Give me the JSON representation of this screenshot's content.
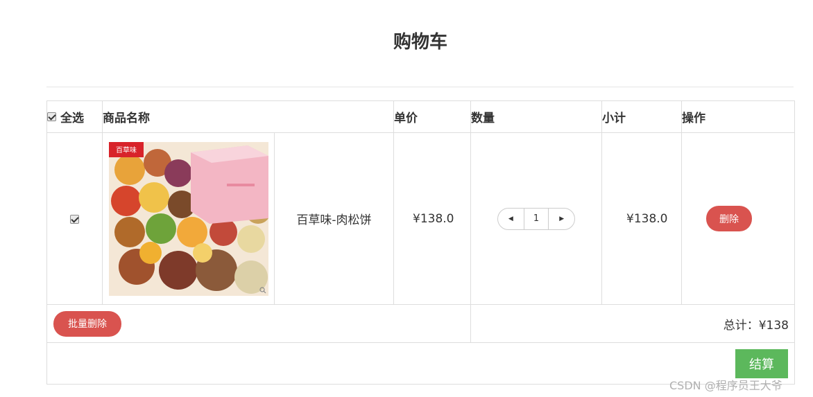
{
  "page": {
    "title": "购物车"
  },
  "table": {
    "headers": {
      "select_all": "全选",
      "product_name": "商品名称",
      "unit_price": "单价",
      "quantity": "数量",
      "subtotal": "小计",
      "actions": "操作"
    },
    "items": [
      {
        "checked": true,
        "name": "百草味-肉松饼",
        "price": "¥138.0",
        "quantity": "1",
        "subtotal": "¥138.0",
        "delete_label": "删除",
        "image_brand_text": "百草味"
      }
    ],
    "select_all_checked": true
  },
  "footer": {
    "batch_delete_label": "批量删除",
    "total_text": "总计：¥138"
  },
  "checkout": {
    "label": "结算"
  },
  "watermark": "CSDN @程序员王大爷",
  "colors": {
    "danger": "#d9534f",
    "success": "#5cb85c",
    "border": "#dddddd"
  },
  "icons": {
    "decrement": "caret-left-icon",
    "increment": "caret-right-icon",
    "zoom": "magnifier-icon"
  }
}
